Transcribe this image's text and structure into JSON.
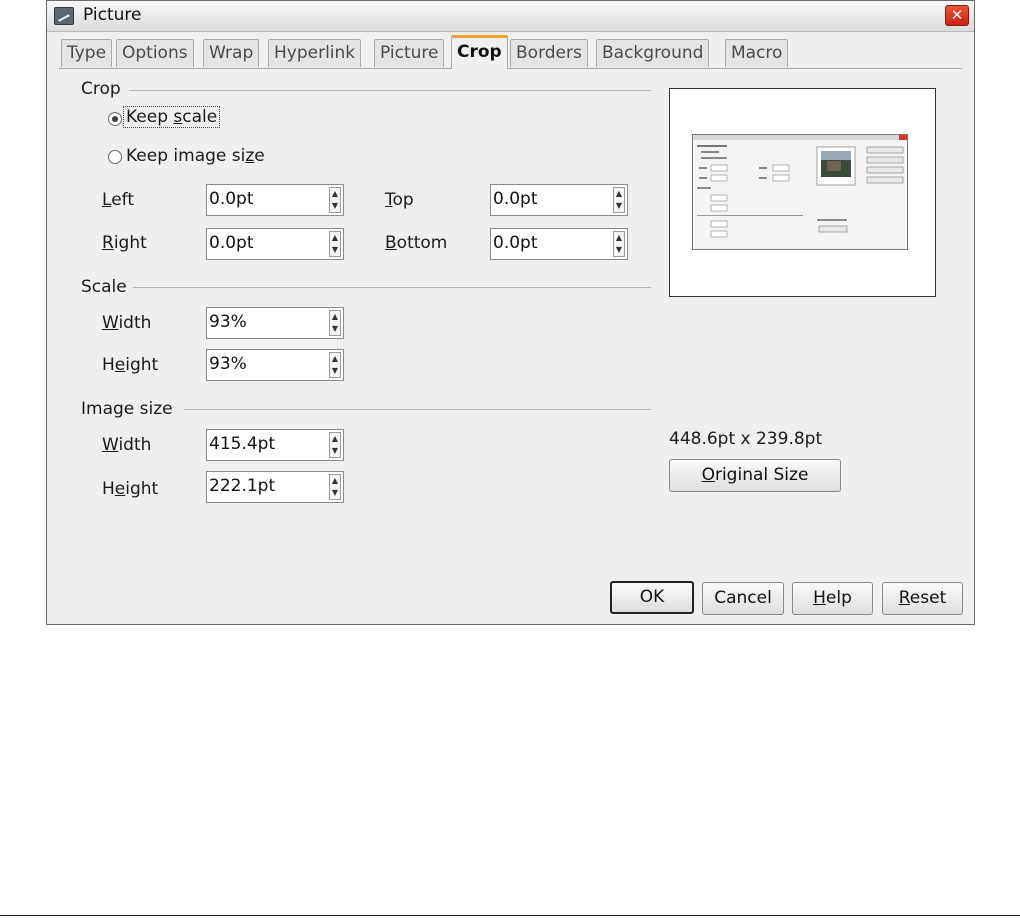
{
  "window": {
    "title": "Picture"
  },
  "tabs": [
    {
      "label": "Type",
      "active": false
    },
    {
      "label": "Options",
      "active": false
    },
    {
      "label": "Wrap",
      "active": false
    },
    {
      "label": "Hyperlink",
      "active": false
    },
    {
      "label": "Picture",
      "active": false
    },
    {
      "label": "Crop",
      "active": true
    },
    {
      "label": "Borders",
      "active": false
    },
    {
      "label": "Background",
      "active": false
    },
    {
      "label": "Macro",
      "active": false
    }
  ],
  "crop": {
    "heading": "Crop",
    "keep_scale": {
      "pre": "Keep ",
      "mn": "s",
      "post": "cale",
      "checked": true
    },
    "keep_image_size": {
      "pre": "Keep image si",
      "mn": "z",
      "post": "e",
      "checked": false
    },
    "left": {
      "mn": "L",
      "label": "eft",
      "value": "0.0pt"
    },
    "right": {
      "mn": "R",
      "label": "ight",
      "value": "0.0pt"
    },
    "top": {
      "mn": "T",
      "label": "op",
      "value": "0.0pt"
    },
    "bottom": {
      "mn": "B",
      "label": "ottom",
      "value": "0.0pt"
    }
  },
  "scale": {
    "heading": "Scale",
    "width": {
      "mn": "W",
      "label": "idth",
      "value": "93%"
    },
    "height": {
      "pre": "H",
      "mn": "e",
      "label": "ight",
      "value": "93%"
    }
  },
  "image_size": {
    "heading": "Image size",
    "width": {
      "mn": "W",
      "label": "idth",
      "value": "415.4pt"
    },
    "height": {
      "pre": "H",
      "mn": "e",
      "label": "ight",
      "value": "222.1pt"
    }
  },
  "original": {
    "dimensions": "448.6pt x 239.8pt",
    "button": {
      "mn": "O",
      "label": "riginal Size"
    }
  },
  "buttons": {
    "ok": "OK",
    "cancel": "Cancel",
    "help": {
      "mn": "H",
      "label": "elp"
    },
    "reset": {
      "mn": "R",
      "label": "eset"
    }
  },
  "colors": {
    "accent_tab": "#f0a030",
    "close": "#d9321f"
  },
  "icons": {
    "app": "picture-icon",
    "close": "close-icon",
    "spin_up": "chevron-up-icon",
    "spin_down": "chevron-down-icon"
  }
}
